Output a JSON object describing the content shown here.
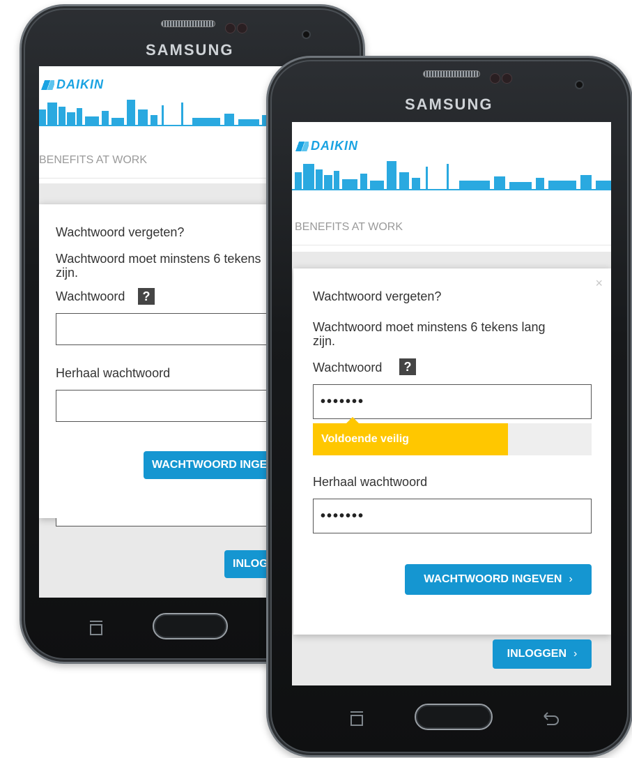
{
  "brand": "SAMSUNG",
  "logo_text": "DAIKIN",
  "colors": {
    "accent": "#1596d1",
    "logo": "#1aa3e2",
    "strength": "#ffc700"
  },
  "back_phone": {
    "section_title": "BENEFITS AT WORK",
    "modal": {
      "title": "Wachtwoord vergeten?",
      "hint_line1": "Wachtwoord moet minstens 6 tekens",
      "hint_line2": "zijn.",
      "password_label": "Wachtwoord",
      "help_glyph": "?",
      "password_value": "",
      "repeat_label": "Herhaal wachtwoord",
      "repeat_value": "",
      "submit_label": "WACHTWOORD INGEV"
    },
    "login_label": "INLOGG"
  },
  "front_phone": {
    "section_title": "BENEFITS AT WORK",
    "modal": {
      "close_glyph": "×",
      "title": "Wachtwoord vergeten?",
      "hint_line1": "Wachtwoord moet minstens 6 tekens lang",
      "hint_line2": "zijn.",
      "password_label": "Wachtwoord",
      "help_glyph": "?",
      "password_value": "•••••••",
      "strength_label": "Voldoende veilig",
      "strength_level": 0.7,
      "repeat_label": "Herhaal wachtwoord",
      "repeat_value": "•••••••",
      "submit_label": "WACHTWOORD INGEVEN",
      "submit_chevron": "›"
    },
    "login_label": "INLOGGEN",
    "login_chevron": "›"
  },
  "icons": {
    "close": "close-icon",
    "help": "help-icon",
    "chevron": "chevron-right-icon",
    "recent_apps": "recent-apps-icon",
    "back": "back-icon"
  }
}
